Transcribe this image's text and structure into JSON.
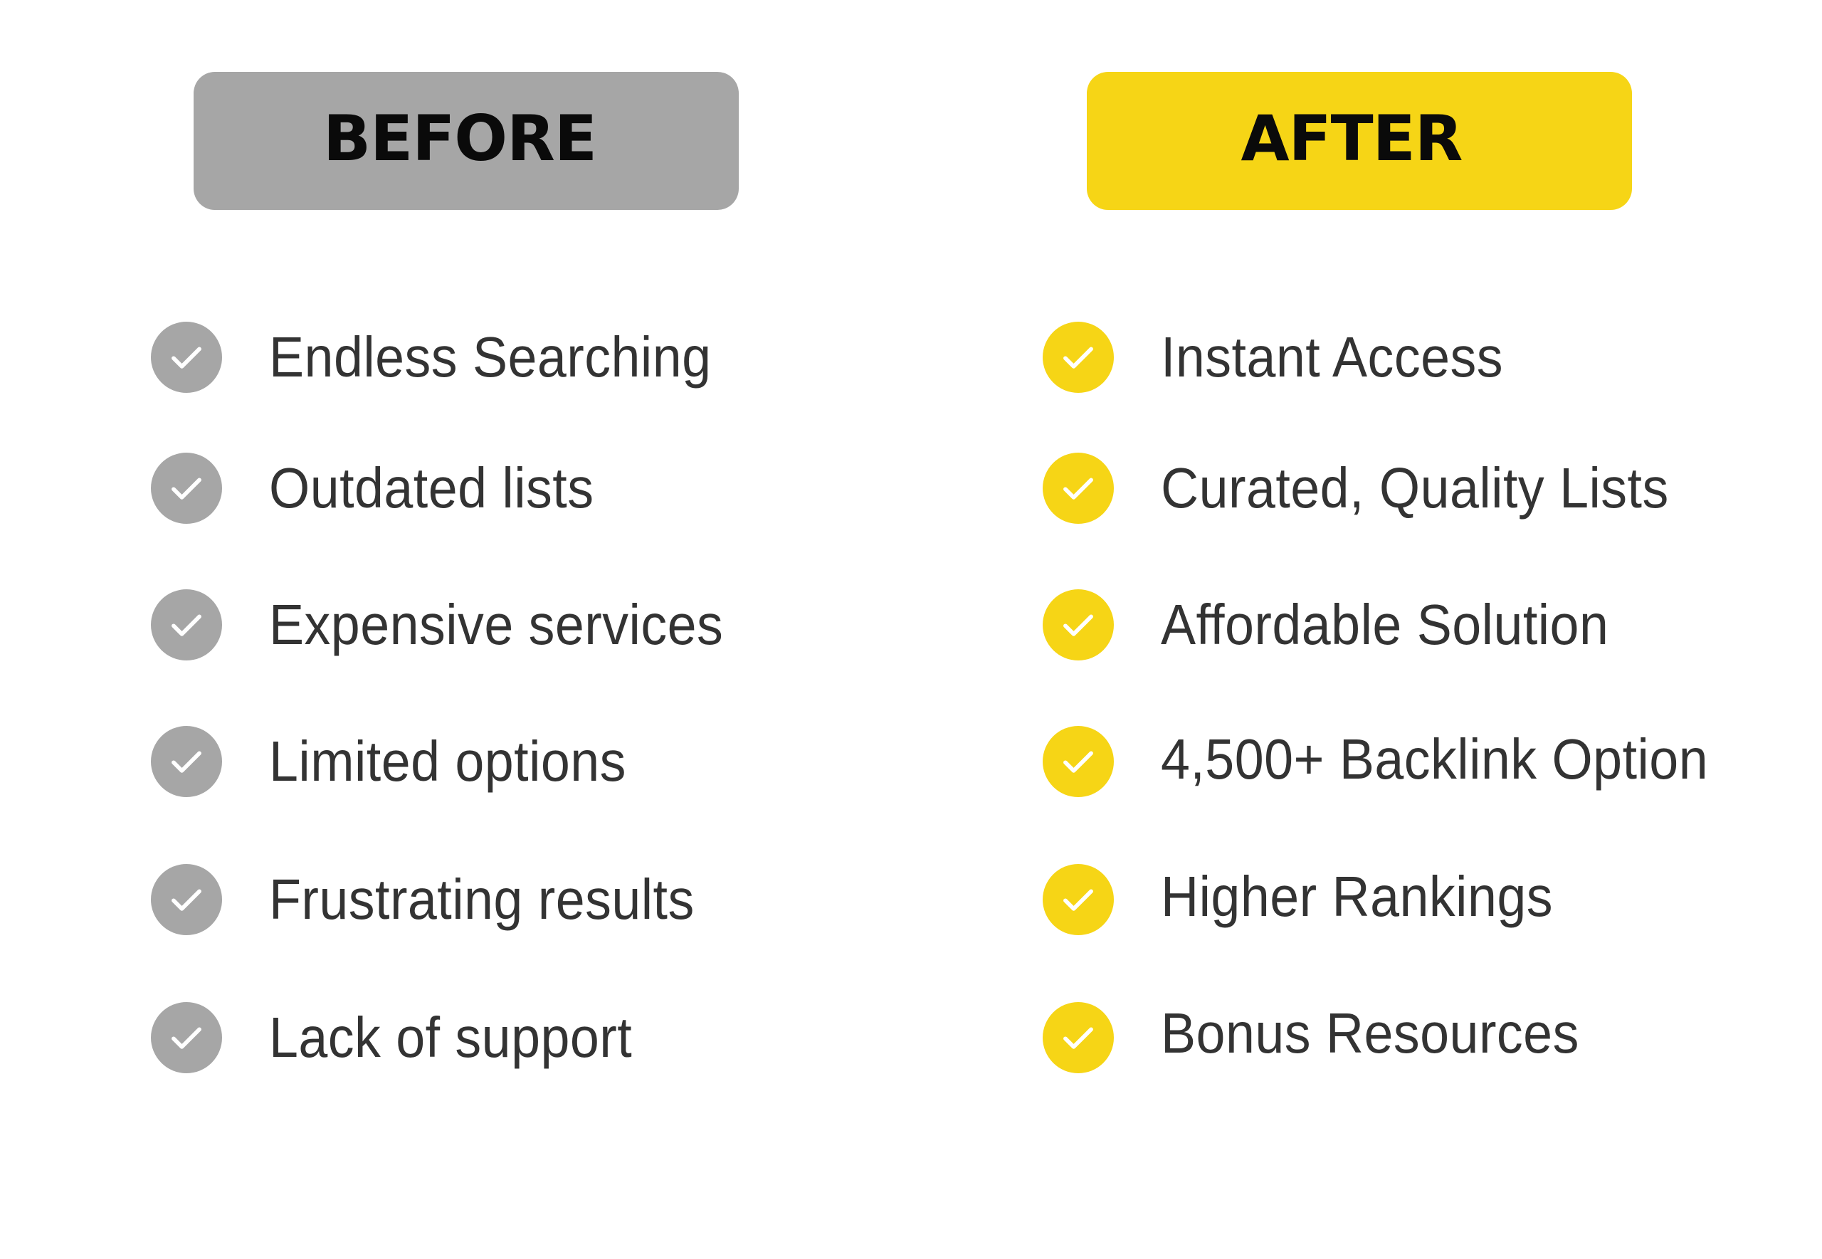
{
  "colors": {
    "before_accent": "#a6a6a6",
    "after_accent": "#f6d516",
    "text": "#333333",
    "heading_text": "#0a0a0a"
  },
  "before": {
    "heading": "BEFORE",
    "icon": "check-circle-icon",
    "items": [
      "Endless Searching",
      "Outdated lists",
      "Expensive services",
      "Limited options",
      "Frustrating results",
      "Lack of support"
    ]
  },
  "after": {
    "heading": "AFTER",
    "icon": "check-circle-icon",
    "items": [
      "Instant Access",
      "Curated, Quality Lists",
      "Affordable Solution",
      "4,500+ Backlink Option",
      "Higher Rankings",
      "Bonus Resources"
    ]
  }
}
